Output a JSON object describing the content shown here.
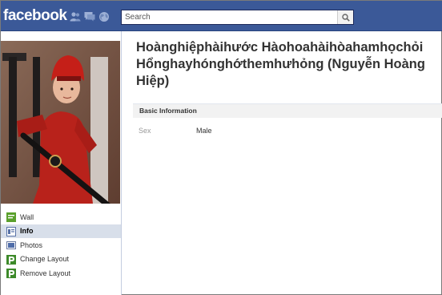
{
  "header": {
    "logo": "facebook",
    "search": {
      "placeholder": "Search",
      "value": ""
    },
    "jewels": [
      "friend-requests-icon",
      "messages-icon",
      "notifications-globe-icon"
    ]
  },
  "profile": {
    "name": "Hoànghiệphàihước Hàohoahàihòahamhọchỏi Hổnghayhónghớthemhưhỏng (Nguyễn Hoàng Hiệp)"
  },
  "sidebar": {
    "items": [
      {
        "label": "Wall",
        "icon": "wall-icon",
        "active": false
      },
      {
        "label": "Info",
        "icon": "info-icon",
        "active": true
      },
      {
        "label": "Photos",
        "icon": "photos-icon",
        "active": false
      },
      {
        "label": "Change Layout",
        "icon": "change-layout-icon",
        "active": false
      },
      {
        "label": "Remove Layout",
        "icon": "remove-layout-icon",
        "active": false
      }
    ]
  },
  "info": {
    "section_title": "Basic Information",
    "rows": [
      {
        "label": "Sex",
        "value": "Male"
      }
    ]
  },
  "colors": {
    "brand": "#3b5998",
    "nav_active": "#d8dfea",
    "section_header_bg": "#f2f2f2"
  }
}
